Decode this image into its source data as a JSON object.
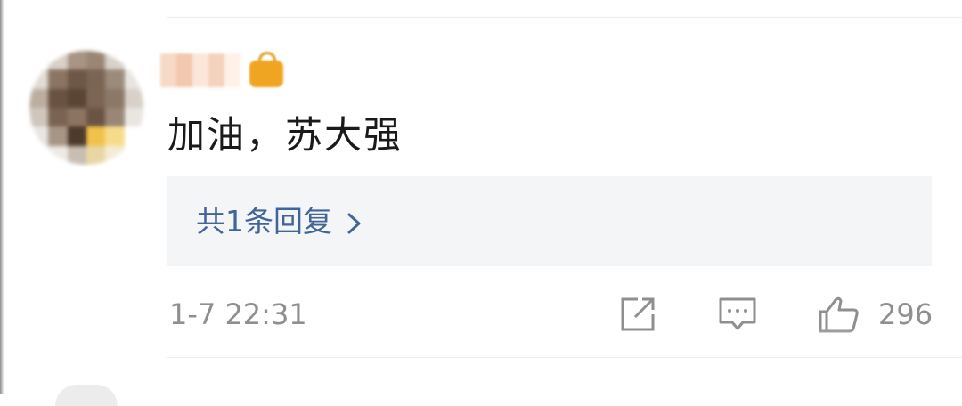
{
  "comment": {
    "text": "加油，苏大强",
    "reply_link_label": "共1条回复",
    "timestamp": "1-7 22:31",
    "like_count": "296"
  },
  "icons": {
    "forward": "share-square-arrow-icon",
    "comment": "comment-bubble-icon",
    "like": "thumbs-up-icon",
    "reply_chevron": "chevron-right-icon",
    "vip": "vip-badge-icon"
  },
  "colors": {
    "link_blue": "#406599",
    "text_primary": "#1a1a1a",
    "text_secondary": "#8f8f8f",
    "reply_bg": "#f4f5f7",
    "badge_orange": "#f0a522"
  }
}
